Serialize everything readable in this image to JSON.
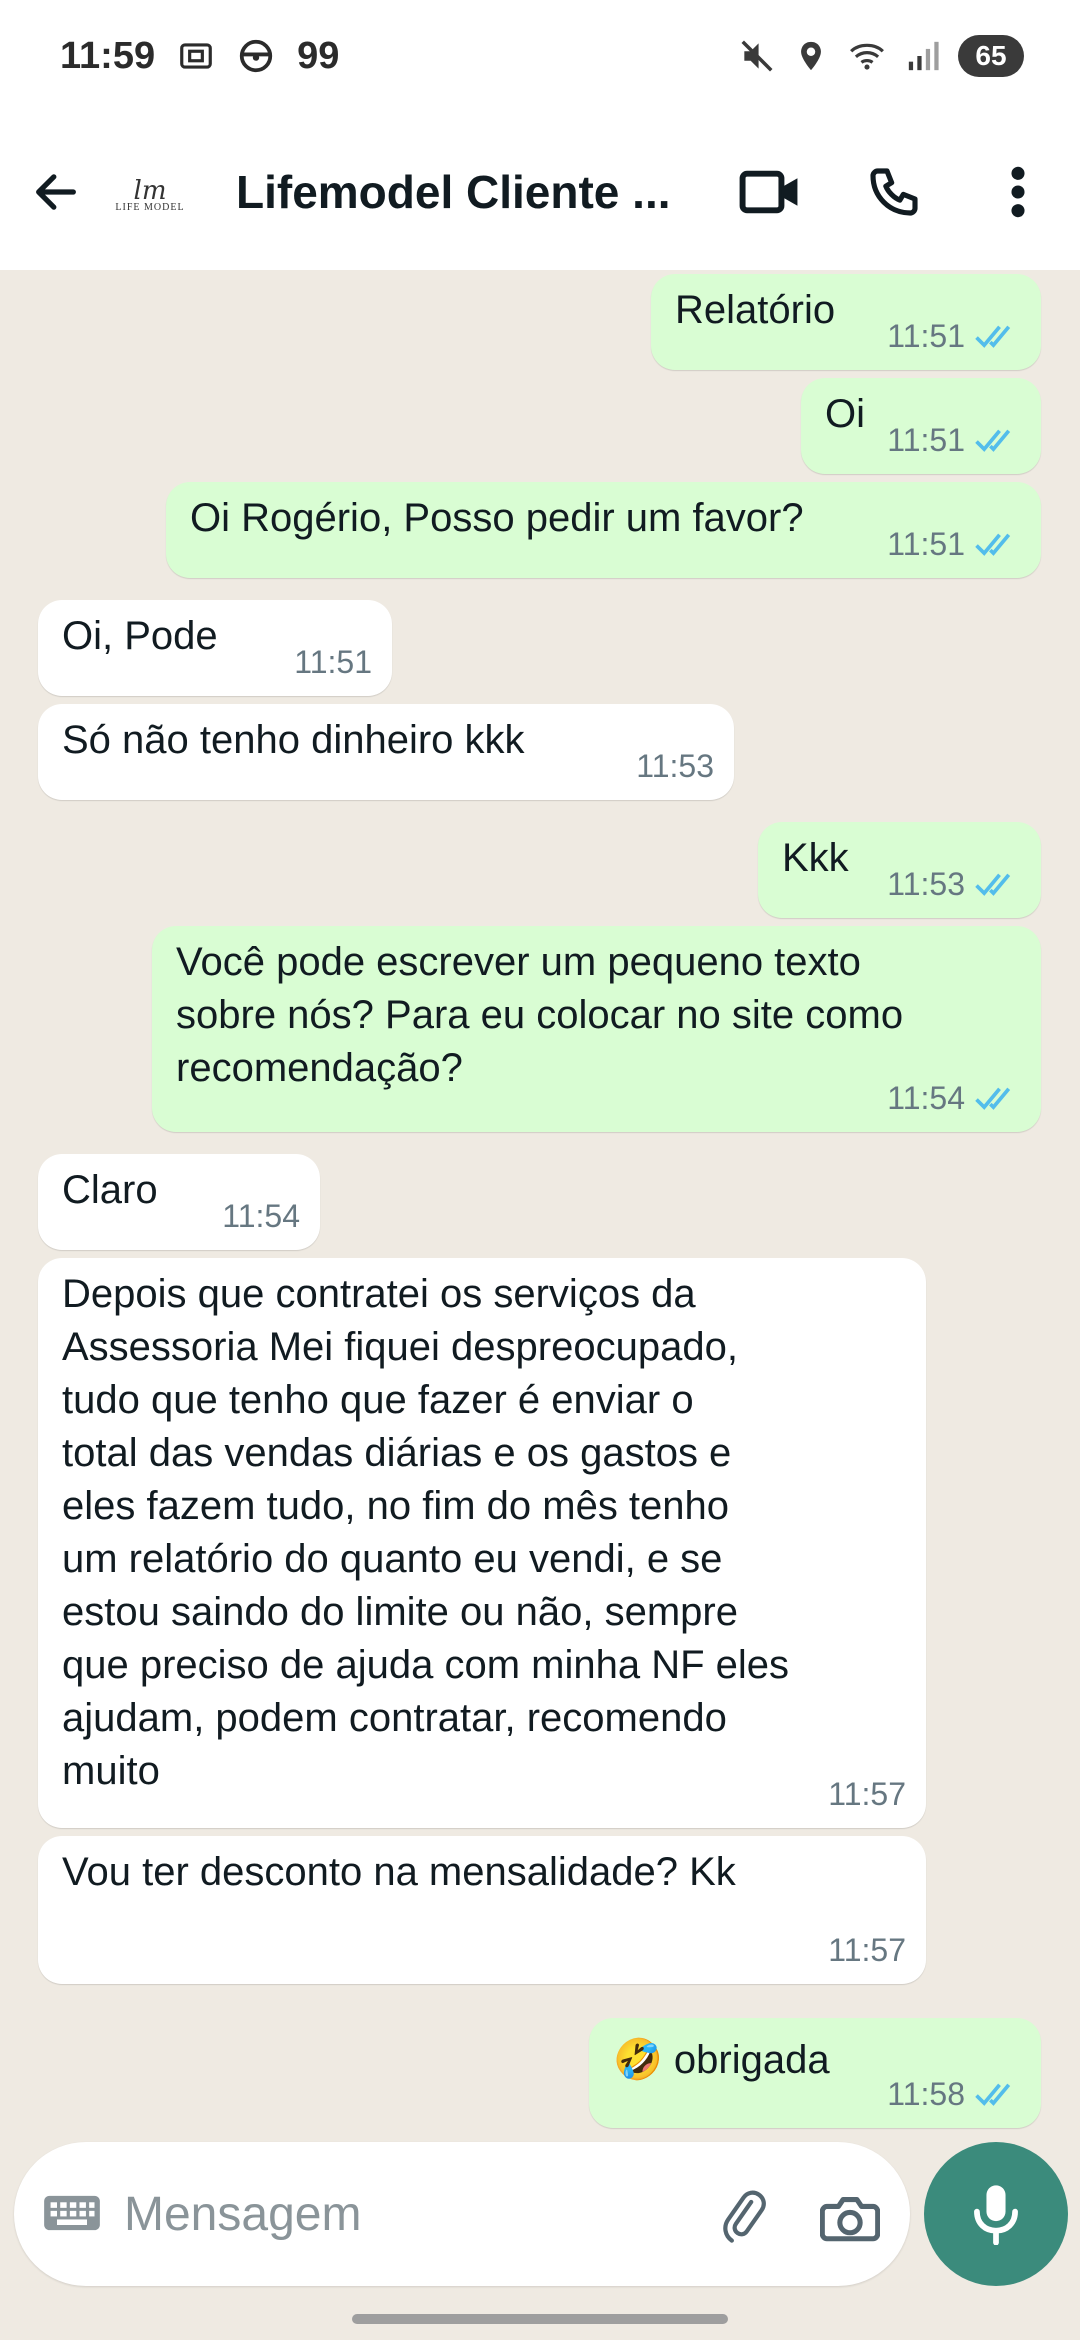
{
  "status_bar": {
    "time": "11:59",
    "notification_count": "99",
    "battery": "65"
  },
  "header": {
    "title": "Lifemodel Cliente ...",
    "avatar_mark": "lm",
    "avatar_text": "LIFE MODEL"
  },
  "messages": [
    {
      "direction": "out",
      "text": "Relatório",
      "time": "11:51",
      "read": true
    },
    {
      "direction": "out",
      "text": "Oi",
      "time": "11:51",
      "read": true
    },
    {
      "direction": "out",
      "text": "Oi Rogério, Posso pedir um favor?",
      "time": "11:51",
      "read": true
    },
    {
      "direction": "in",
      "text": "Oi, Pode",
      "time": "11:51"
    },
    {
      "direction": "in",
      "text": "Só não tenho dinheiro kkk",
      "time": "11:53"
    },
    {
      "direction": "out",
      "text": "Kkk",
      "time": "11:53",
      "read": true
    },
    {
      "direction": "out",
      "text": "Você pode escrever um pequeno texto\nsobre nós? Para eu colocar no site como\nrecomendação?",
      "time": "11:54",
      "read": true
    },
    {
      "direction": "in",
      "text": "Claro",
      "time": "11:54"
    },
    {
      "direction": "in",
      "text": "Depois que contratei os serviços da\nAssessoria Mei fiquei despreocupado,\ntudo que tenho que fazer é enviar o\ntotal das vendas diárias e os gastos e\neles fazem tudo, no fim do mês tenho\num relatório do quanto eu vendi, e se\nestou saindo do limite ou não, sempre\nque preciso de ajuda com minha NF eles\najudam, podem contratar, recomendo\nmuito",
      "time": "11:57"
    },
    {
      "direction": "in",
      "text": "Vou ter desconto na mensalidade? Kk",
      "time": "11:57"
    },
    {
      "direction": "out",
      "text": "🤣 obrigada",
      "time": "11:58",
      "read": true
    }
  ],
  "composer": {
    "placeholder": "Mensagem"
  },
  "colors": {
    "outgoing_bubble": "#d9fdd3",
    "incoming_bubble": "#ffffff",
    "chat_background": "#efeae2",
    "read_ticks": "#53bdeb",
    "mic_button": "#3b8b7c"
  },
  "icons": {
    "back": "arrow-left-icon",
    "video": "video-camera-icon",
    "call": "phone-icon",
    "menu": "more-vertical-icon",
    "keyboard": "keyboard-icon",
    "attach": "paperclip-icon",
    "camera": "camera-icon",
    "mic": "microphone-icon"
  }
}
